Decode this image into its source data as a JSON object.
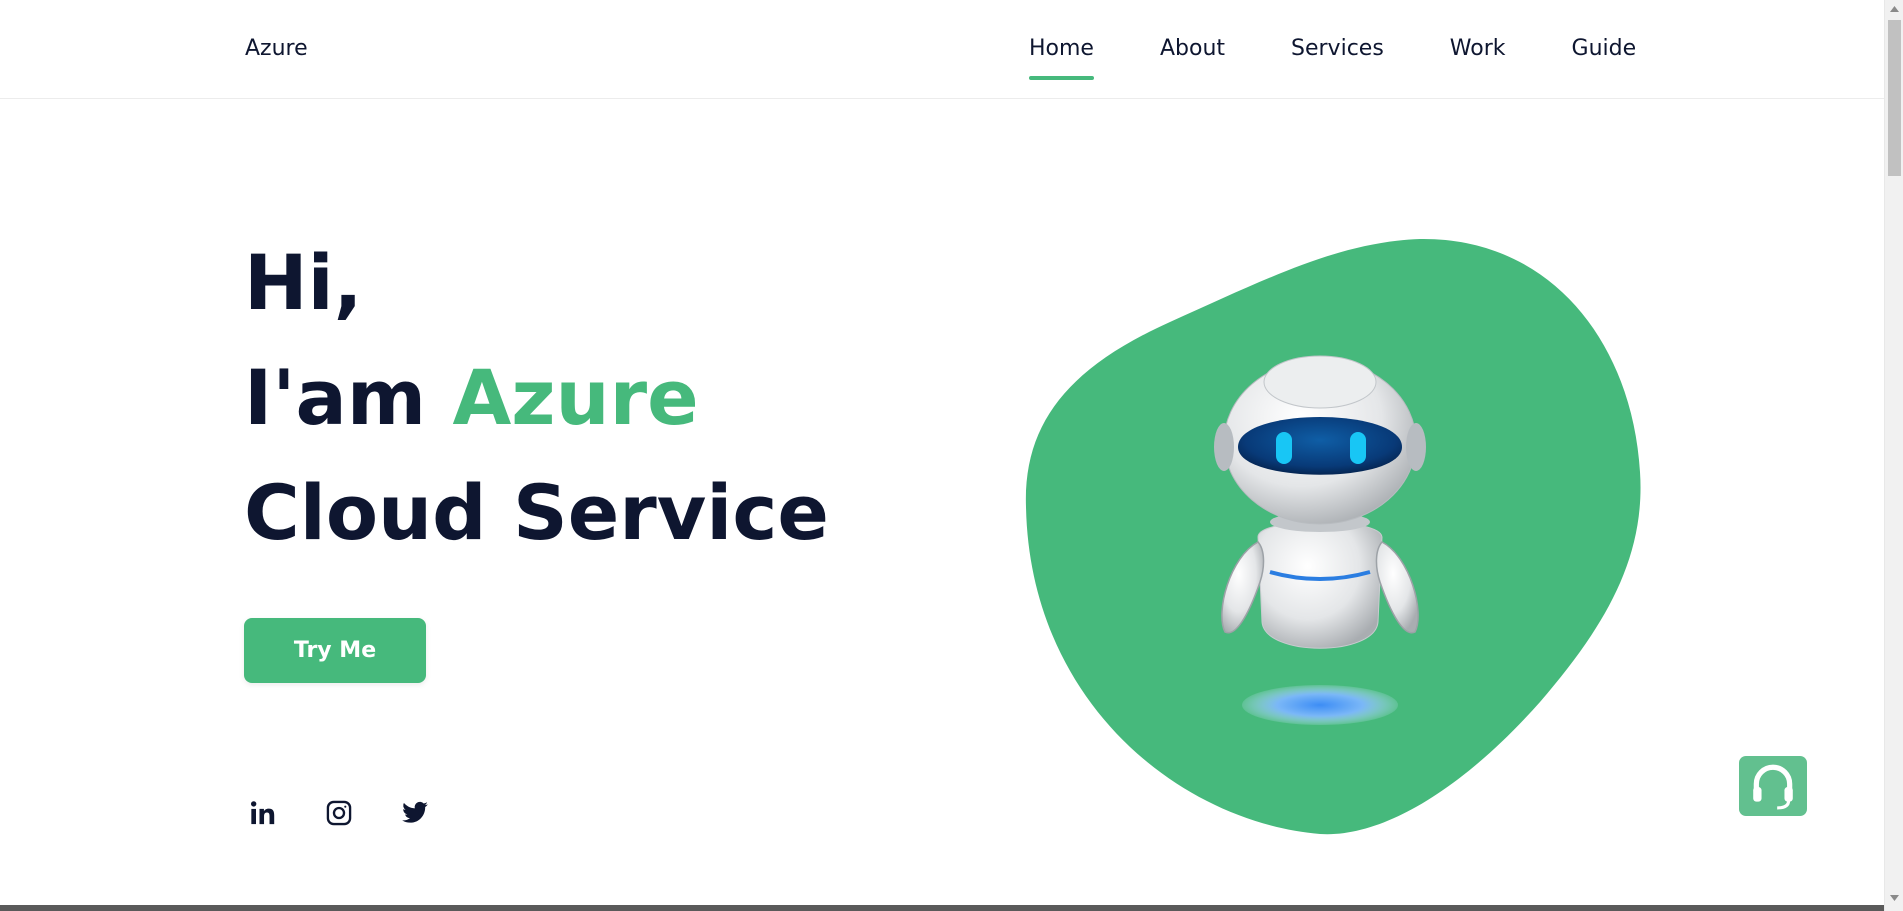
{
  "header": {
    "logo": "Azure",
    "nav": [
      {
        "label": "Home",
        "active": true
      },
      {
        "label": "About",
        "active": false
      },
      {
        "label": "Services",
        "active": false
      },
      {
        "label": "Work",
        "active": false
      },
      {
        "label": "Guide",
        "active": false
      }
    ]
  },
  "hero": {
    "line1": "Hi,",
    "line2_prefix": "I'am ",
    "line2_accent": "Azure",
    "line3": "Cloud Service",
    "cta_label": "Try Me"
  },
  "socials": [
    "linkedin-icon",
    "instagram-icon",
    "twitter-icon"
  ],
  "colors": {
    "accent": "#46b97c",
    "text": "#0e1630",
    "support": "#62c08f"
  }
}
